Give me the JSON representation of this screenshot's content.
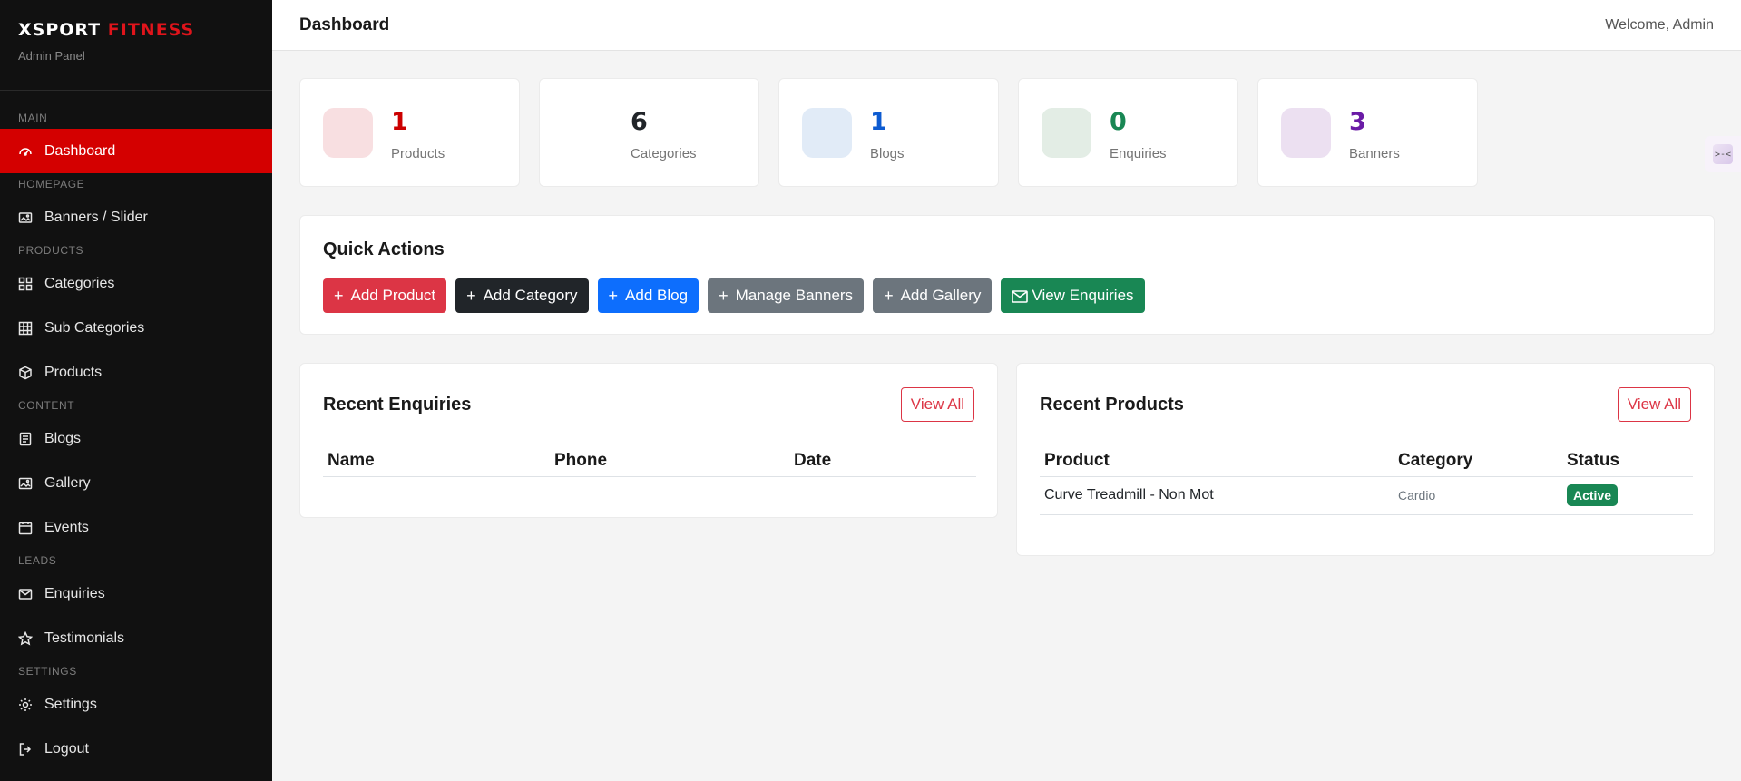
{
  "brand": {
    "title_main": "XSPORT",
    "title_accent": "FITNESS",
    "subtitle": "Admin Panel"
  },
  "sidebar": {
    "sections": {
      "main": "MAIN",
      "homepage": "HOMEPAGE",
      "products": "PRODUCTS",
      "content": "CONTENT",
      "leads": "LEADS",
      "settings": "SETTINGS"
    },
    "items": {
      "dashboard": "Dashboard",
      "banners": "Banners / Slider",
      "categories": "Categories",
      "sub_categories": "Sub Categories",
      "products": "Products",
      "blogs": "Blogs",
      "gallery": "Gallery",
      "events": "Events",
      "enquiries": "Enquiries",
      "testimonials": "Testimonials",
      "settings": "Settings",
      "logout": "Logout"
    }
  },
  "header": {
    "title": "Dashboard",
    "welcome": "Welcome, Admin"
  },
  "stats": [
    {
      "value": "1",
      "label": "Products",
      "color": "#cc0000",
      "icon_bg": "#f8dfe1"
    },
    {
      "value": "6",
      "label": "Categories",
      "color": "#212529",
      "icon_bg": "#ffffff"
    },
    {
      "value": "1",
      "label": "Blogs",
      "color": "#0d5bd1",
      "icon_bg": "#e1ebf7"
    },
    {
      "value": "0",
      "label": "Enquiries",
      "color": "#198754",
      "icon_bg": "#e3ede5"
    },
    {
      "value": "3",
      "label": "Banners",
      "color": "#6a1ba6",
      "icon_bg": "#ece0f1"
    }
  ],
  "quick_actions": {
    "title": "Quick Actions",
    "buttons": {
      "add_product": "Add Product",
      "add_category": "Add Category",
      "add_blog": "Add Blog",
      "manage_banners": "Manage Banners",
      "add_gallery": "Add Gallery",
      "view_enquiries": "View Enquiries"
    },
    "colors": {
      "add_product": "#dc3545",
      "add_category": "#212529",
      "add_blog": "#0d6efd",
      "manage_banners": "#6c757d",
      "add_gallery": "#6c757d",
      "view_enquiries": "#198754"
    }
  },
  "recent_enquiries": {
    "title": "Recent Enquiries",
    "view_all": "View All",
    "columns": {
      "name": "Name",
      "phone": "Phone",
      "date": "Date"
    }
  },
  "recent_products": {
    "title": "Recent Products",
    "view_all": "View All",
    "columns": {
      "product": "Product",
      "category": "Category",
      "status": "Status"
    },
    "rows": [
      {
        "product": "Curve Treadmill - Non Mot",
        "category": "Cardio",
        "status": "Active"
      }
    ]
  },
  "side_toggle": {
    "glyph": ">-<"
  }
}
